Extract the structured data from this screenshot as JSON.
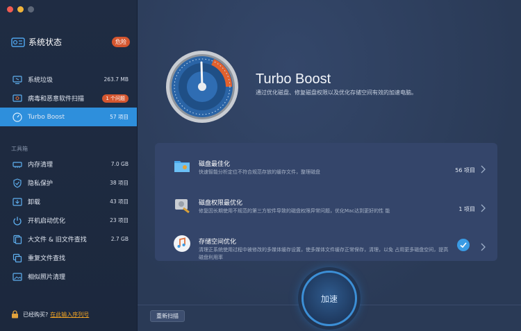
{
  "sidebar": {
    "status_title": "系统状态",
    "status_badge": "危险",
    "scan_items": [
      {
        "label": "系统垃圾",
        "value": "263.7 MB",
        "icon": "monitor-trash-icon"
      },
      {
        "label": "病毒和恶意软件扫描",
        "value": "1 个问题",
        "icon": "virus-shield-icon",
        "pill": true
      },
      {
        "label": "Turbo Boost",
        "value": "57 项目",
        "icon": "speedometer-icon",
        "active": true
      }
    ],
    "tools_label": "工具箱",
    "tool_items": [
      {
        "label": "内存清理",
        "value": "7.0 GB",
        "icon": "memory-icon"
      },
      {
        "label": "隐私保护",
        "value": "38 项目",
        "icon": "privacy-shield-icon"
      },
      {
        "label": "卸载",
        "value": "43 项目",
        "icon": "uninstall-icon"
      },
      {
        "label": "开机启动优化",
        "value": "23 项目",
        "icon": "power-icon"
      },
      {
        "label": "大文件 & 旧文件查找",
        "value": "2.7 GB",
        "icon": "files-icon"
      },
      {
        "label": "重复文件查找",
        "value": "",
        "icon": "duplicate-icon"
      },
      {
        "label": "相似照片清理",
        "value": "",
        "icon": "photo-icon"
      }
    ],
    "footer_text": "已经购买?",
    "footer_link": "在此输入序列号"
  },
  "hero": {
    "title": "Turbo Boost",
    "description": "通过优化磁盘、修复磁盘权限以及优化存储空间有效的加速电脑。"
  },
  "rows": [
    {
      "title": "磁盘最佳化",
      "desc": "快速智能分析定位不符合规范存放的缓存文件，整理磁盘",
      "count": "56 项目"
    },
    {
      "title": "磁盘权限最优化",
      "desc": "修复因长期使用不规范的第三方软件导致的磁盘权限异常问题，优化Mac达到更好的性 能",
      "count": "1 项目"
    },
    {
      "title": "存储空间优化",
      "desc": "清理正系统使用过程中被修改的多媒体缓存设置，使多媒体文件缓存正常保存，清理，以免 占用更多磁盘空间，提高磁盘利用率",
      "count": ""
    }
  ],
  "buttons": {
    "rescan": "重新扫描",
    "boost": "加速"
  },
  "colors": {
    "accent": "#2e8fdc",
    "danger": "#d4562f",
    "link": "#f5a623"
  }
}
